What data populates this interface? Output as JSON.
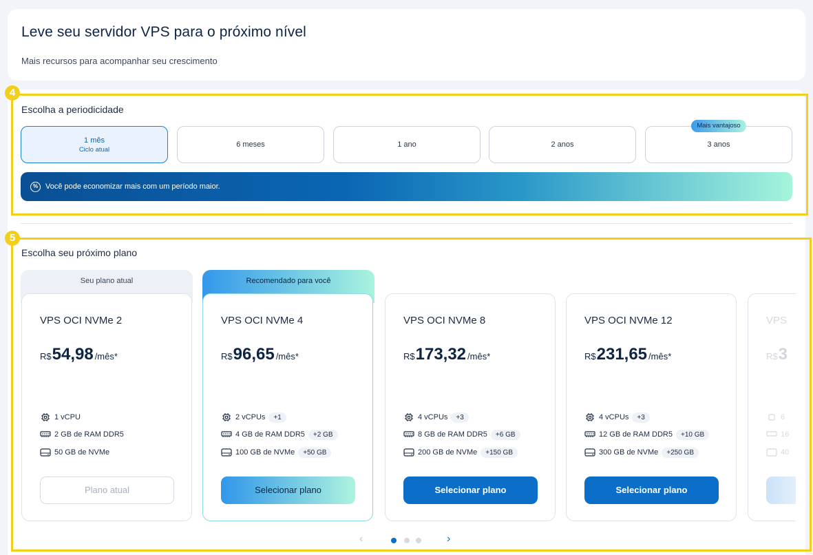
{
  "header": {
    "title": "Leve seu servidor VPS para o próximo nível",
    "subtitle": "Mais recursos para acompanhar seu crescimento"
  },
  "annotations": {
    "step4": "4",
    "step5": "5"
  },
  "period": {
    "label": "Escolha a periodicidade",
    "options": [
      {
        "label": "1 mês",
        "sub": "Ciclo atual",
        "active": true
      },
      {
        "label": "6 meses"
      },
      {
        "label": "1 ano"
      },
      {
        "label": "2 anos"
      },
      {
        "label": "3 anos",
        "tag": "Mais vantajoso"
      }
    ],
    "banner": "Você pode economizar mais com um período maior."
  },
  "plans": {
    "label": "Escolha seu próximo plano",
    "current_tag": "Seu plano atual",
    "recommended_tag": "Recomendado para você",
    "items": [
      {
        "name": "VPS OCI NVMe 2",
        "currency": "R$",
        "price": "54,98",
        "period": "/mês*",
        "cpu": "1 vCPU",
        "cpu_up": "",
        "ram_value": "2 GB",
        "ram_text": "de RAM DDR5",
        "ram_up": "",
        "disk_value": "50 GB",
        "disk_text": "de NVMe",
        "disk_up": "",
        "button": "Plano atual"
      },
      {
        "name": "VPS OCI NVMe 4",
        "currency": "R$",
        "price": "96,65",
        "period": "/mês*",
        "cpu": "2 vCPUs",
        "cpu_up": "+1",
        "ram_value": "4 GB",
        "ram_text": "de RAM DDR5",
        "ram_up": "+2 GB",
        "disk_value": "100 GB",
        "disk_text": "de NVMe",
        "disk_up": "+50 GB",
        "button": "Selecionar plano"
      },
      {
        "name": "VPS OCI NVMe 8",
        "currency": "R$",
        "price": "173,32",
        "period": "/mês*",
        "cpu": "4 vCPUs",
        "cpu_up": "+3",
        "ram_value": "8 GB",
        "ram_text": "de RAM DDR5",
        "ram_up": "+6 GB",
        "disk_value": "200 GB",
        "disk_text": "de NVMe",
        "disk_up": "+150 GB",
        "button": "Selecionar plano"
      },
      {
        "name": "VPS OCI NVMe 12",
        "currency": "R$",
        "price": "231,65",
        "period": "/mês*",
        "cpu": "4 vCPUs",
        "cpu_up": "+3",
        "ram_value": "12 GB",
        "ram_text": "de RAM DDR5",
        "ram_up": "+10 GB",
        "disk_value": "300 GB",
        "disk_text": "de NVMe",
        "disk_up": "+250 GB",
        "button": "Selecionar plano"
      },
      {
        "name": "VPS",
        "currency": "R$",
        "price": "3",
        "cpu": "6",
        "ram_value": "16",
        "disk_value": "40"
      }
    ]
  },
  "pager": {
    "prev_icon": "‹",
    "next_icon": "›",
    "pages": 3,
    "current": 1
  }
}
